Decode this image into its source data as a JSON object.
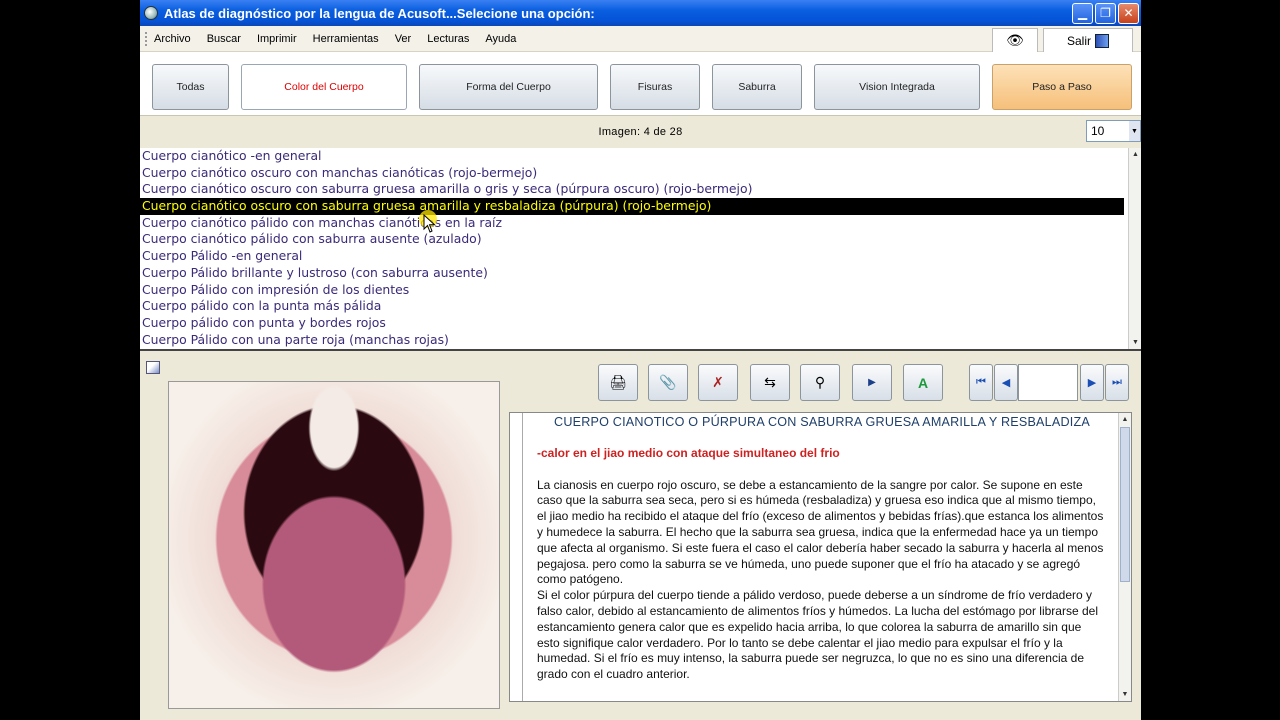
{
  "window": {
    "title": "Atlas de diagnóstico por la lengua de Acusoft...Selecione una opción:",
    "controls": {
      "minimize": "▁",
      "maximize": "❐",
      "close": "✕"
    }
  },
  "menu": {
    "items": [
      "Archivo",
      "Buscar",
      "Imprimir",
      "Herramientas",
      "Ver",
      "Lecturas",
      "Ayuda"
    ],
    "eye_icon": "👁",
    "salir_label": "Salir"
  },
  "categories": [
    {
      "label": "Todas"
    },
    {
      "label": "Color del Cuerpo"
    },
    {
      "label": "Forma del Cuerpo"
    },
    {
      "label": "Fisuras"
    },
    {
      "label": "Saburra"
    },
    {
      "label": "Vision Integrada"
    },
    {
      "label": "Paso a Paso"
    }
  ],
  "counter": {
    "label": "Imagen:",
    "current": "4",
    "separator": "de",
    "total": "28",
    "page_size": "10"
  },
  "list": {
    "selected_index": 3,
    "items": [
      "Cuerpo cianótico -en general",
      "Cuerpo cianótico oscuro con manchas cianóticas (rojo-bermejo)",
      "Cuerpo cianótico oscuro con saburra gruesa amarilla o gris y seca (púrpura oscuro) (rojo-bermejo)",
      "Cuerpo cianótico oscuro con saburra gruesa amarilla y resbaladiza (púrpura) (rojo-bermejo)",
      "Cuerpo cianótico pálido con manchas cianóticas en la raíz",
      "Cuerpo cianótico pálido con saburra ausente (azulado)",
      "Cuerpo Pálido -en general",
      "Cuerpo Pálido brillante y lustroso (con saburra ausente)",
      "Cuerpo Pálido con impresión de los dientes",
      "Cuerpo pálido con la punta más pálida",
      "Cuerpo pálido con punta y bordes rojos",
      "Cuerpo Pálido con una parte roja (manchas rojas)"
    ]
  },
  "actions": {
    "print_icon": "🖨",
    "clip_icon": "📎",
    "delete_icon": "✗",
    "export_icon": "⇆",
    "find_icon": "⚲",
    "play_icon": "▶",
    "font_icon": "A"
  },
  "nav": {
    "first": "⏮",
    "prev": "◀",
    "next": "▶",
    "last": "⏭",
    "page_value": ""
  },
  "document": {
    "title": "CUERPO CIANOTICO O PÚRPURA CON SABURRA GRUESA AMARILLA Y RESBALADIZA",
    "subtitle": "-calor en el jiao medio con ataque simultaneo del frio",
    "para1": "La cianosis en cuerpo rojo oscuro, se debe a estancamiento de la sangre por calor. Se supone en este caso que la saburra sea seca, pero si es húmeda (resbaladiza) y gruesa eso indica que al mismo tiempo, el jiao medio ha recibido el ataque del frío (exceso de alimentos y bebidas frías).que estanca los alimentos y humedece la saburra. El hecho que la saburra sea gruesa, indica que la enfermedad hace ya un tiempo que afecta al organismo. Si este fuera el caso el calor debería haber secado la saburra y hacerla al menos pegajosa. pero como la saburra se ve húmeda, uno puede suponer que el frío ha atacado y se agregó como patógeno.",
    "para2": "Si el color púrpura del cuerpo tiende a pálido verdoso, puede deberse a un síndrome de frío verdadero y falso calor, debido al estancamiento de alimentos fríos y húmedos. La lucha del estómago por librarse del estancamiento genera calor que es expelido hacia arriba, lo que colorea la saburra de amarillo sin que esto signifique calor verdadero. Por lo tanto se debe calentar el jiao medio para expulsar el frío y la humedad. Si el frío es muy intenso, la saburra puede ser negruzca, lo que no es sino una diferencia de grado con el cuadro anterior."
  }
}
